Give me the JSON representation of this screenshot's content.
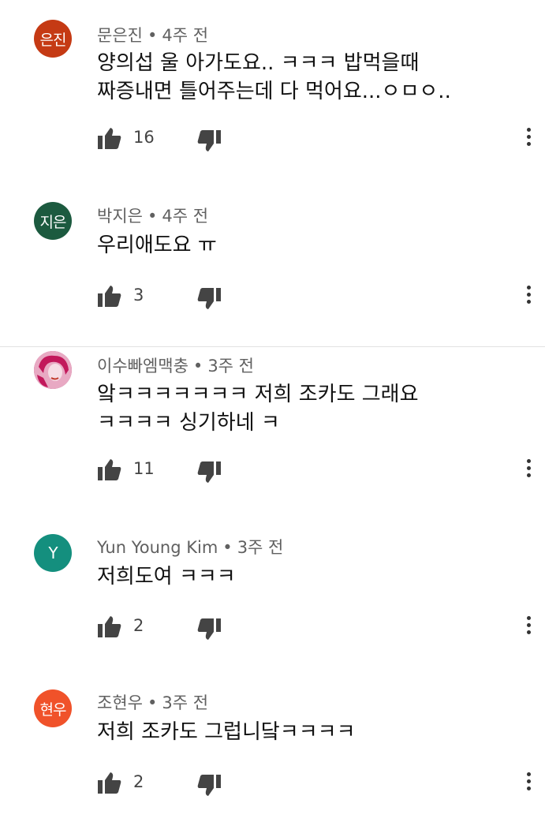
{
  "comments": [
    {
      "author": "문은진",
      "age": "4주 전",
      "avatar_text": "은진",
      "avatar_color": "#c53a14",
      "text": "양의섭 울 아가도요.. ㅋㅋㅋ 밥먹을때\n짜증내면 틀어주는데 다 먹어요...ㅇㅁㅇ..",
      "likes": "16"
    },
    {
      "author": "박지은",
      "age": "4주 전",
      "avatar_text": "지은",
      "avatar_color": "#1c5a3f",
      "text": "우리애도요 ㅠ",
      "likes": "3"
    },
    {
      "author": "이수빠엠맥충",
      "age": "3주 전",
      "avatar_text": "",
      "avatar_color": "#d94f87",
      "text": "앜ㅋㅋㅋㅋㅋㅋㅋ 저희 조카도 그래요\nㅋㅋㅋㅋ 싱기하네 ㅋ",
      "likes": "11"
    },
    {
      "author": "Yun Young Kim",
      "age": "3주 전",
      "avatar_text": "Y",
      "avatar_color": "#148f7e",
      "text": "저희도여 ㅋㅋㅋ",
      "likes": "2"
    },
    {
      "author": "조현우",
      "age": "3주 전",
      "avatar_text": "현우",
      "avatar_color": "#f0522a",
      "text": "저희 조카도 그럽니닼ㅋㅋㅋㅋ",
      "likes": "2"
    }
  ],
  "separator": "•"
}
